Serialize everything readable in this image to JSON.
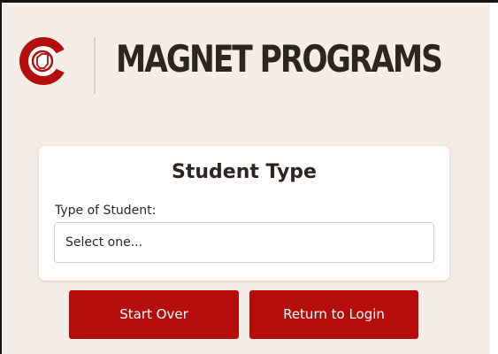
{
  "header": {
    "logo_icon": "district-c-logo-icon",
    "title": "MAGNET PROGRAMS"
  },
  "student_type_card": {
    "title": "Student Type",
    "field_label": "Type of Student:",
    "select_value": "Select one..."
  },
  "actions": {
    "start_over": "Start Over",
    "return_to_login": "Return to Login"
  },
  "colors": {
    "brand_red": "#b50c0c",
    "background": "#f5ede7",
    "text": "#2b2622"
  }
}
